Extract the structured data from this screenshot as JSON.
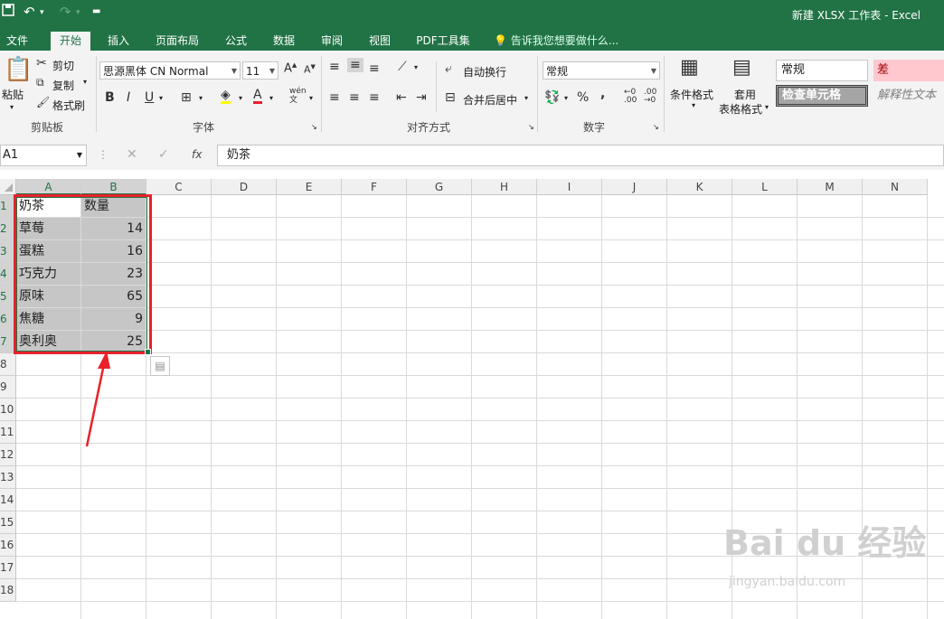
{
  "app": {
    "title": "新建 XLSX 工作表 - Excel",
    "undo_icon": "undo-icon",
    "redo_icon": "redo-icon"
  },
  "tabs": [
    "文件",
    "开始",
    "插入",
    "页面布局",
    "公式",
    "数据",
    "审阅",
    "视图",
    "PDF工具集"
  ],
  "active_tab": "开始",
  "tell_me": "告诉我您想要做什么...",
  "ribbon": {
    "clipboard": {
      "paste": "粘贴",
      "cut": "剪切",
      "copy": "复制",
      "format_painter": "格式刷",
      "label": "剪贴板"
    },
    "font": {
      "name": "思源黑体 CN Normal",
      "size": "11",
      "bold": "B",
      "italic": "I",
      "underline": "U",
      "label": "字体",
      "phonetic": "wén"
    },
    "alignment": {
      "wrap": "自动换行",
      "merge": "合并后居中",
      "label": "对齐方式"
    },
    "number": {
      "format": "常规",
      "percent": "%",
      "comma": ",",
      "label": "数字"
    },
    "styles": {
      "conditional": "条件格式",
      "table_line1": "套用",
      "table_line2": "表格格式",
      "normal": "常规",
      "bad": "差",
      "check": "检查单元格",
      "explanatory": "解释性文本"
    }
  },
  "formula_bar": {
    "name_box": "A1",
    "fx": "fx",
    "value": "奶茶"
  },
  "columns": [
    "A",
    "B",
    "C",
    "D",
    "E",
    "F",
    "G",
    "H",
    "I",
    "J",
    "K",
    "L",
    "M",
    "N"
  ],
  "rows": [
    "1",
    "2",
    "3",
    "4",
    "5",
    "6",
    "7",
    "8",
    "9",
    "10",
    "11",
    "12",
    "13",
    "14",
    "15",
    "16",
    "17",
    "18"
  ],
  "table": {
    "header": [
      "奶茶",
      "数量"
    ],
    "rows": [
      [
        "草莓",
        "14"
      ],
      [
        "蛋糕",
        "16"
      ],
      [
        "巧克力",
        "23"
      ],
      [
        "原味",
        "65"
      ],
      [
        "焦糖",
        "9"
      ],
      [
        "奥利奥",
        "25"
      ]
    ]
  },
  "colors": {
    "brand": "#217346",
    "highlight": "#e8212b",
    "bad_fill": "#ffc7ce",
    "bad_text": "#9c0006"
  },
  "watermark": {
    "brand": "Bai du 经验",
    "url": "jingyan.baidu.com"
  }
}
